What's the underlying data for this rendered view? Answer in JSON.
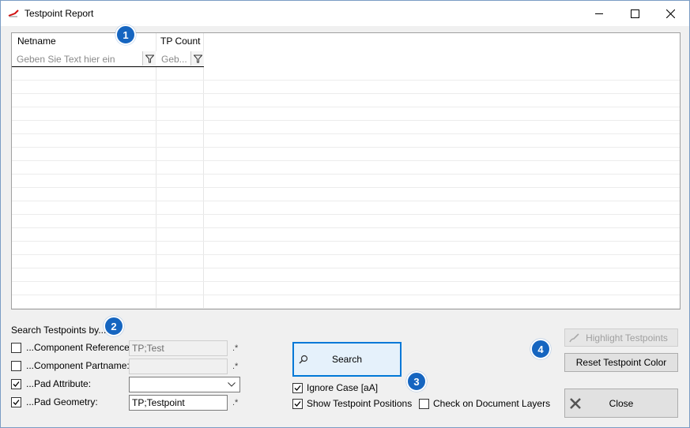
{
  "window": {
    "title": "Testpoint Report",
    "minimize_icon": "minimize-icon",
    "maximize_icon": "maximize-icon",
    "close_icon": "close-icon"
  },
  "grid": {
    "columns": [
      {
        "label": "Netname",
        "filter_placeholder": "Geben Sie Text hier ein"
      },
      {
        "label": "TP Count",
        "filter_placeholder": "Geb..."
      }
    ],
    "rows": []
  },
  "markers": [
    "1",
    "2",
    "3",
    "4"
  ],
  "search": {
    "section_label": "Search Testpoints by...",
    "component_reference": {
      "label": "...Component Reference:",
      "checked": false,
      "value": "TP;Test",
      "suffix": ".*"
    },
    "component_partname": {
      "label": "...Component Partname:",
      "checked": false,
      "value": "",
      "suffix": ".*"
    },
    "pad_attribute": {
      "label": "...Pad Attribute:",
      "checked": true,
      "value": ""
    },
    "pad_geometry": {
      "label": "...Pad Geometry:",
      "checked": true,
      "value": "TP;Testpoint",
      "suffix": ".*"
    },
    "search_button": "Search",
    "ignore_case": {
      "label": "Ignore Case [aA]",
      "checked": true
    },
    "show_positions": {
      "label": "Show Testpoint Positions",
      "checked": true
    },
    "check_document_layers": {
      "label": "Check on Document Layers",
      "checked": false
    }
  },
  "actions": {
    "highlight_label": "Highlight Testpoints",
    "reset_color_label": "Reset Testpoint Color",
    "close_label": "Close"
  },
  "colors": {
    "marker": "#1565c0",
    "window_border": "#7a9cc4",
    "search_border": "#0078d7"
  }
}
